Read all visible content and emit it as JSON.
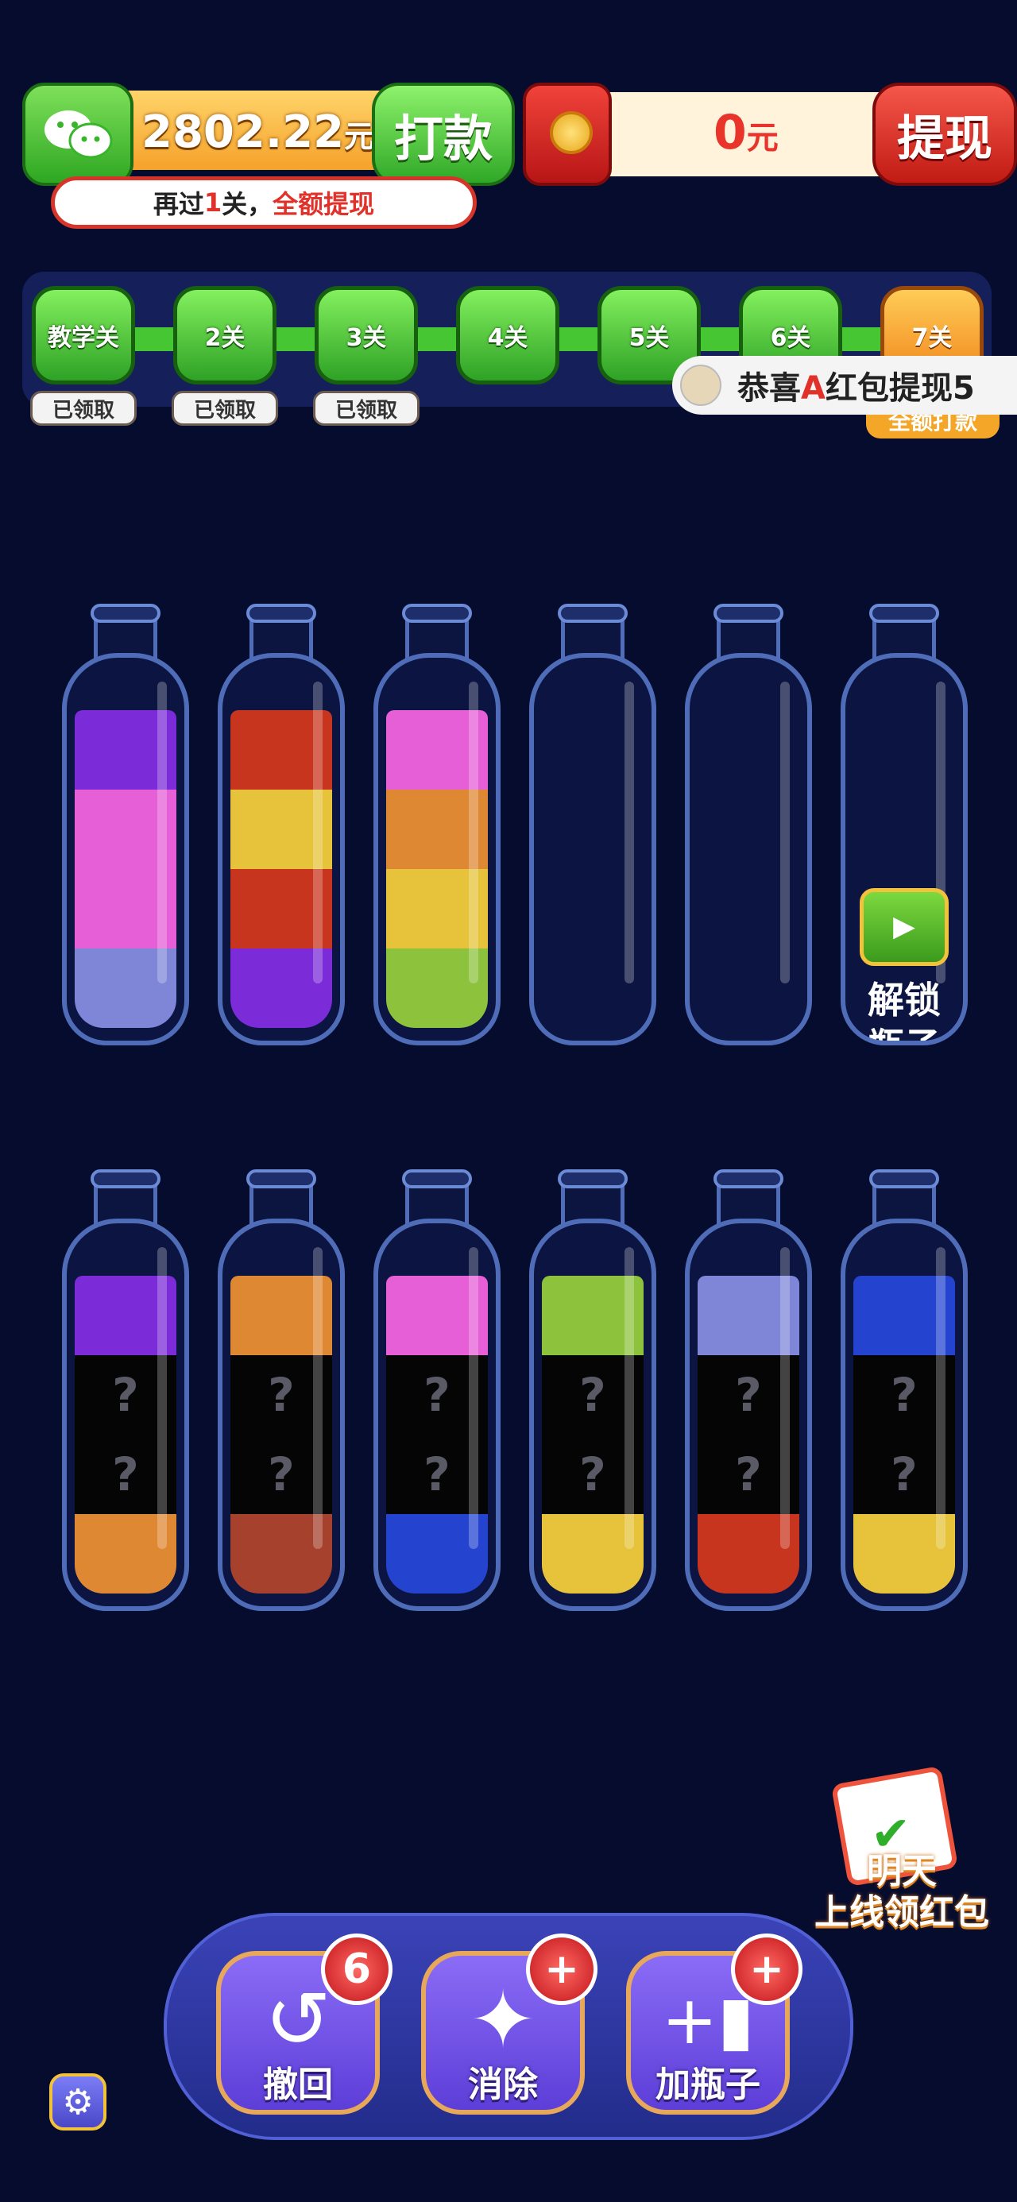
{
  "wallet": {
    "amount": "2802.22",
    "unit": "元",
    "pay_label": "打款"
  },
  "hint": {
    "prefix": "再过",
    "count": "1",
    "middle": "关，",
    "highlight": "全额提现"
  },
  "redpacket": {
    "amount": "0",
    "unit": "元",
    "withdraw_label": "提现"
  },
  "levels": [
    {
      "label": "教学关",
      "claim": "已领取"
    },
    {
      "label": "2关",
      "claim": "已领取"
    },
    {
      "label": "3关",
      "claim": "已领取"
    },
    {
      "label": "4关",
      "claim": ""
    },
    {
      "label": "5关",
      "claim": ""
    },
    {
      "label": "6关",
      "claim": ""
    },
    {
      "label": "7关",
      "claim": ""
    }
  ],
  "toast": {
    "prefix": "恭喜",
    "name": "A",
    "suffix": "红包提现5"
  },
  "level7_tag": "全额打款",
  "colors": {
    "purple": "#7b2cd8",
    "pink": "#e65fd7",
    "lavender": "#7f86d8",
    "red": "#c8351e",
    "yellow": "#e6c33a",
    "orange": "#df8833",
    "green": "#8cc23c",
    "brown": "#a6412e",
    "blue": "#2444d0",
    "unknown": "#050505"
  },
  "bottles_row1": [
    {
      "layers": [
        "lavender",
        "pink",
        "pink",
        "purple"
      ]
    },
    {
      "layers": [
        "purple",
        "red",
        "yellow",
        "red"
      ]
    },
    {
      "layers": [
        "green",
        "yellow",
        "orange",
        "pink"
      ]
    },
    {
      "layers": []
    },
    {
      "layers": []
    },
    {
      "layers": [],
      "locked": true
    }
  ],
  "lock_label_1": "解锁",
  "lock_label_2": "瓶子",
  "bottles_row2": [
    {
      "layers": [
        "orange",
        "unknown",
        "unknown",
        "purple"
      ]
    },
    {
      "layers": [
        "brown",
        "unknown",
        "unknown",
        "orange"
      ]
    },
    {
      "layers": [
        "blue",
        "unknown",
        "unknown",
        "pink"
      ]
    },
    {
      "layers": [
        "yellow",
        "unknown",
        "unknown",
        "green"
      ]
    },
    {
      "layers": [
        "red",
        "unknown",
        "unknown",
        "lavender"
      ]
    },
    {
      "layers": [
        "yellow",
        "unknown",
        "unknown",
        "blue"
      ]
    }
  ],
  "unknown_mark": "?",
  "tools": [
    {
      "label": "撤回",
      "badge": "6",
      "icon": "undo-icon"
    },
    {
      "label": "消除",
      "badge": "+",
      "icon": "magic-wand-icon"
    },
    {
      "label": "加瓶子",
      "badge": "+",
      "icon": "add-bottle-icon"
    }
  ],
  "daily": {
    "line1": "明天",
    "line2": "上线领红包"
  }
}
